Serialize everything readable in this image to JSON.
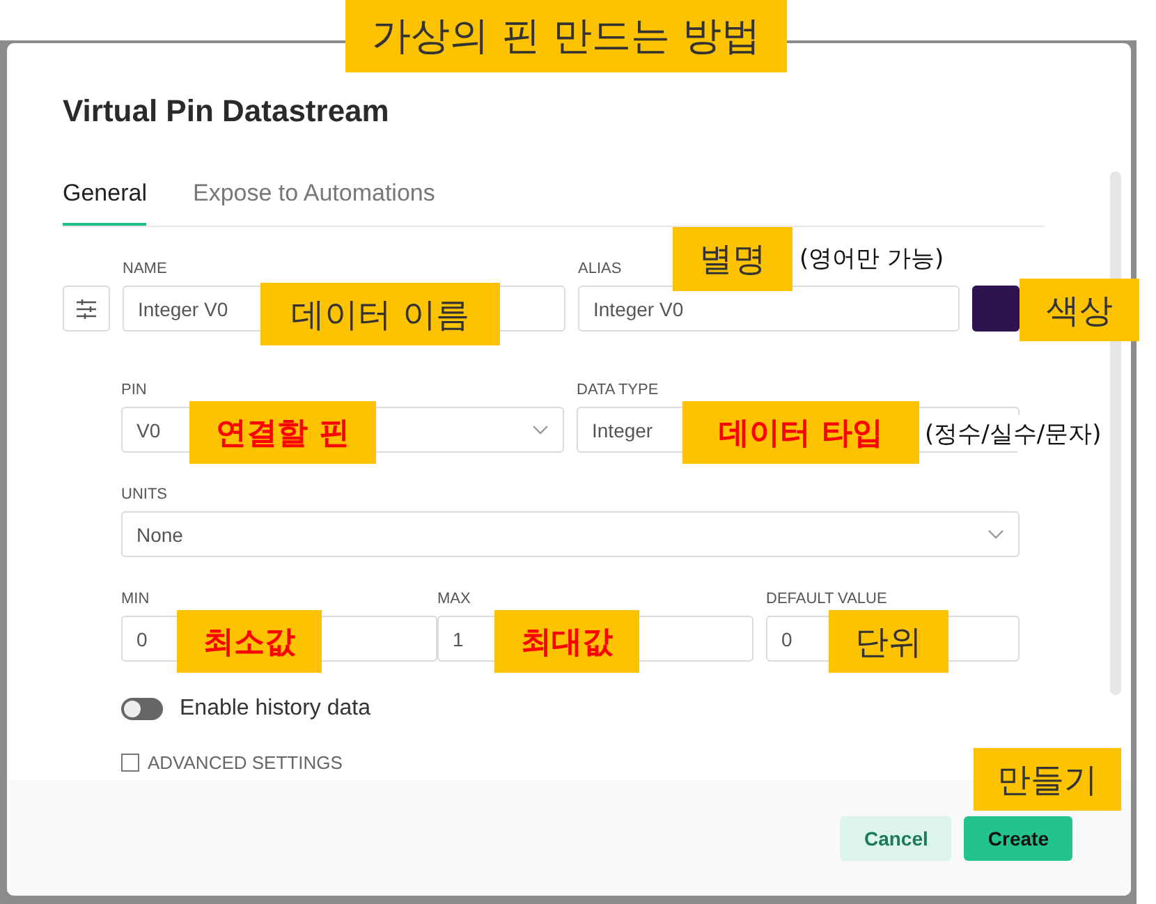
{
  "dialog": {
    "title": "Virtual Pin Datastream",
    "tabs": [
      {
        "label": "General",
        "selected": true
      },
      {
        "label": "Expose to Automations",
        "selected": false
      }
    ],
    "name": {
      "label": "NAME",
      "value": "Integer V0"
    },
    "alias": {
      "label": "ALIAS",
      "value": "Integer V0"
    },
    "color": "#2d1450",
    "pin": {
      "label": "PIN",
      "value": "V0"
    },
    "data_type": {
      "label": "DATA TYPE",
      "value": "Integer"
    },
    "units": {
      "label": "UNITS",
      "value": "None"
    },
    "min": {
      "label": "MIN",
      "value": "0"
    },
    "max": {
      "label": "MAX",
      "value": "1"
    },
    "default_value": {
      "label": "DEFAULT VALUE",
      "value": "0"
    },
    "history": {
      "label": "Enable history data",
      "on": false
    },
    "advanced": {
      "label": "ADVANCED SETTINGS"
    },
    "buttons": [
      {
        "label": "Cancel",
        "kind": "secondary"
      },
      {
        "label": "Create",
        "kind": "primary"
      }
    ]
  },
  "annotations": [
    {
      "text": "가상의 핀 만드는 방법",
      "kind": "label",
      "emphasis": false
    },
    {
      "text": "데이터 이름",
      "kind": "label",
      "emphasis": false
    },
    {
      "text": "별명",
      "kind": "label",
      "emphasis": false
    },
    {
      "text": "(영어만 가능)",
      "kind": "note"
    },
    {
      "text": "색상",
      "kind": "label",
      "emphasis": false
    },
    {
      "text": "연결할 핀",
      "kind": "label",
      "emphasis": true
    },
    {
      "text": "데이터 타입",
      "kind": "label",
      "emphasis": true
    },
    {
      "text": "(정수/실수/문자)",
      "kind": "note"
    },
    {
      "text": "최소값",
      "kind": "label",
      "emphasis": true
    },
    {
      "text": "최대값",
      "kind": "label",
      "emphasis": true
    },
    {
      "text": "단위",
      "kind": "label",
      "emphasis": false
    },
    {
      "text": "만들기",
      "kind": "label",
      "emphasis": false
    }
  ]
}
